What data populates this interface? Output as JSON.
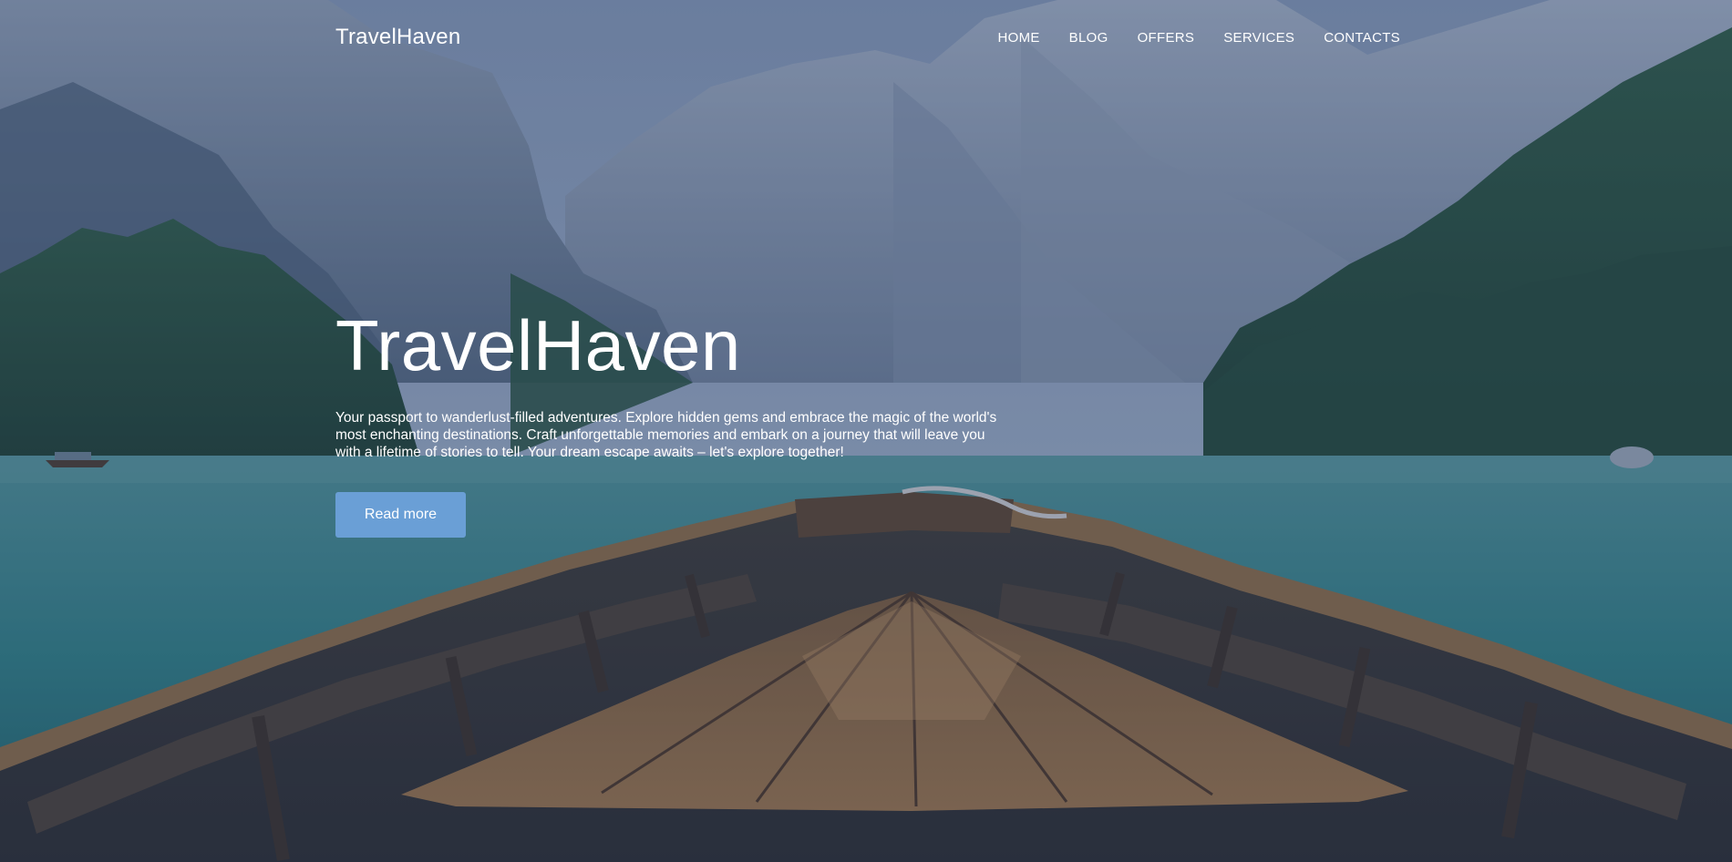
{
  "header": {
    "brand": "TravelHaven",
    "nav": [
      {
        "label": "HOME"
      },
      {
        "label": "BLOG"
      },
      {
        "label": "OFFERS"
      },
      {
        "label": "SERVICES"
      },
      {
        "label": "CONTACTS"
      }
    ]
  },
  "hero": {
    "title": "TravelHaven",
    "description": "Your passport to wanderlust-filled adventures. Explore hidden gems and embrace the magic of the world's most enchanting destinations. Craft unforgettable memories and embark on a journey that will leave you with a lifetime of stories to tell. Your dream escape awaits – let's explore together!",
    "button_label": "Read more",
    "background": "mountain-lake-boat-photo"
  },
  "colors": {
    "overlay": "#283e64",
    "button": "#6a9fd6",
    "text": "#ffffff"
  }
}
